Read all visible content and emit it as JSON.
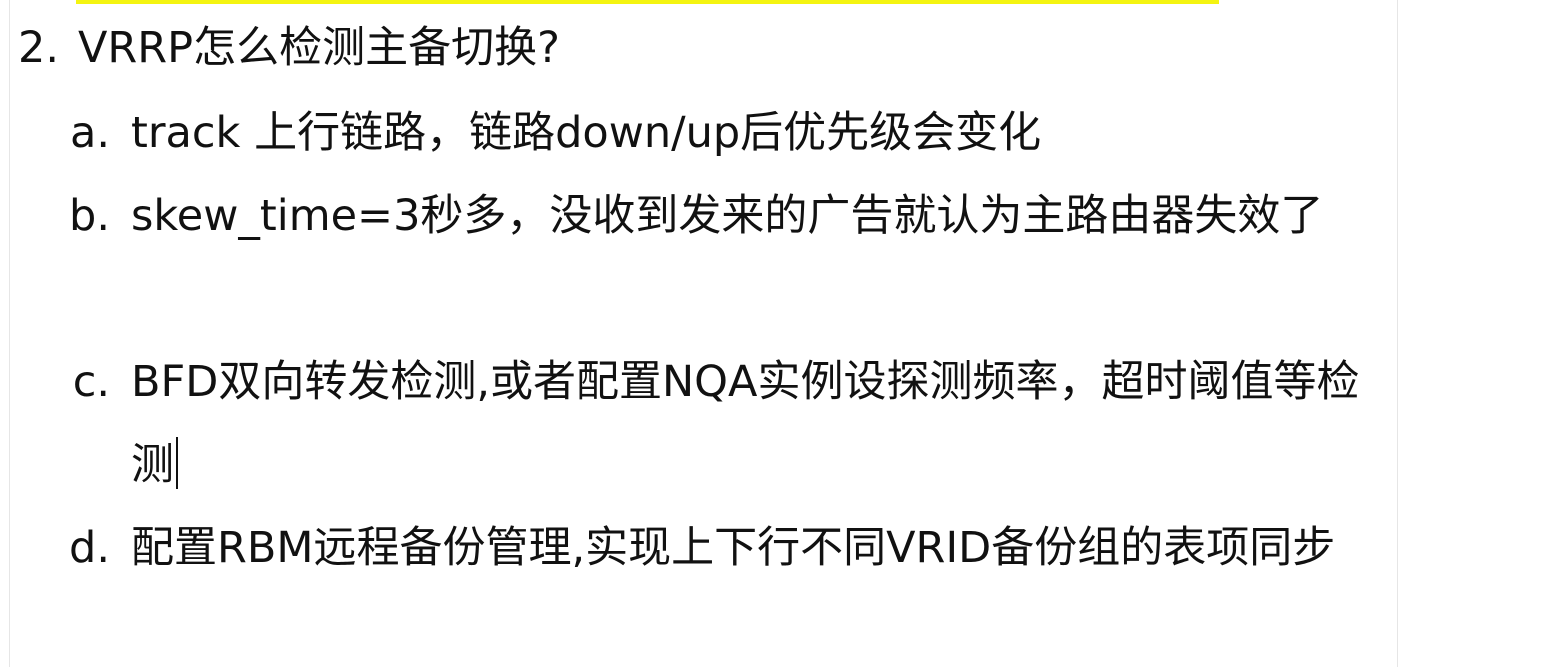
{
  "heading": {
    "number": "2.",
    "text": "VRRP怎么检测主备切换?"
  },
  "items": [
    {
      "marker": "a.",
      "text": "track 上行链路，链路down/up后优先级会变化"
    },
    {
      "marker": "b.",
      "text": "skew_time=3秒多，没收到发来的广告就认为主路由器失效了"
    },
    {
      "marker": "c.",
      "text": "BFD双向转发检测,或者配置NQA实例设探测频率，超时阈值等检测"
    },
    {
      "marker": "d.",
      "text": "配置RBM远程备份管理,实现上下行不同VRID备份组的表项同步"
    }
  ],
  "colors": {
    "highlight": "#f4f411",
    "text": "#111111",
    "border": "#e6e6e6"
  }
}
